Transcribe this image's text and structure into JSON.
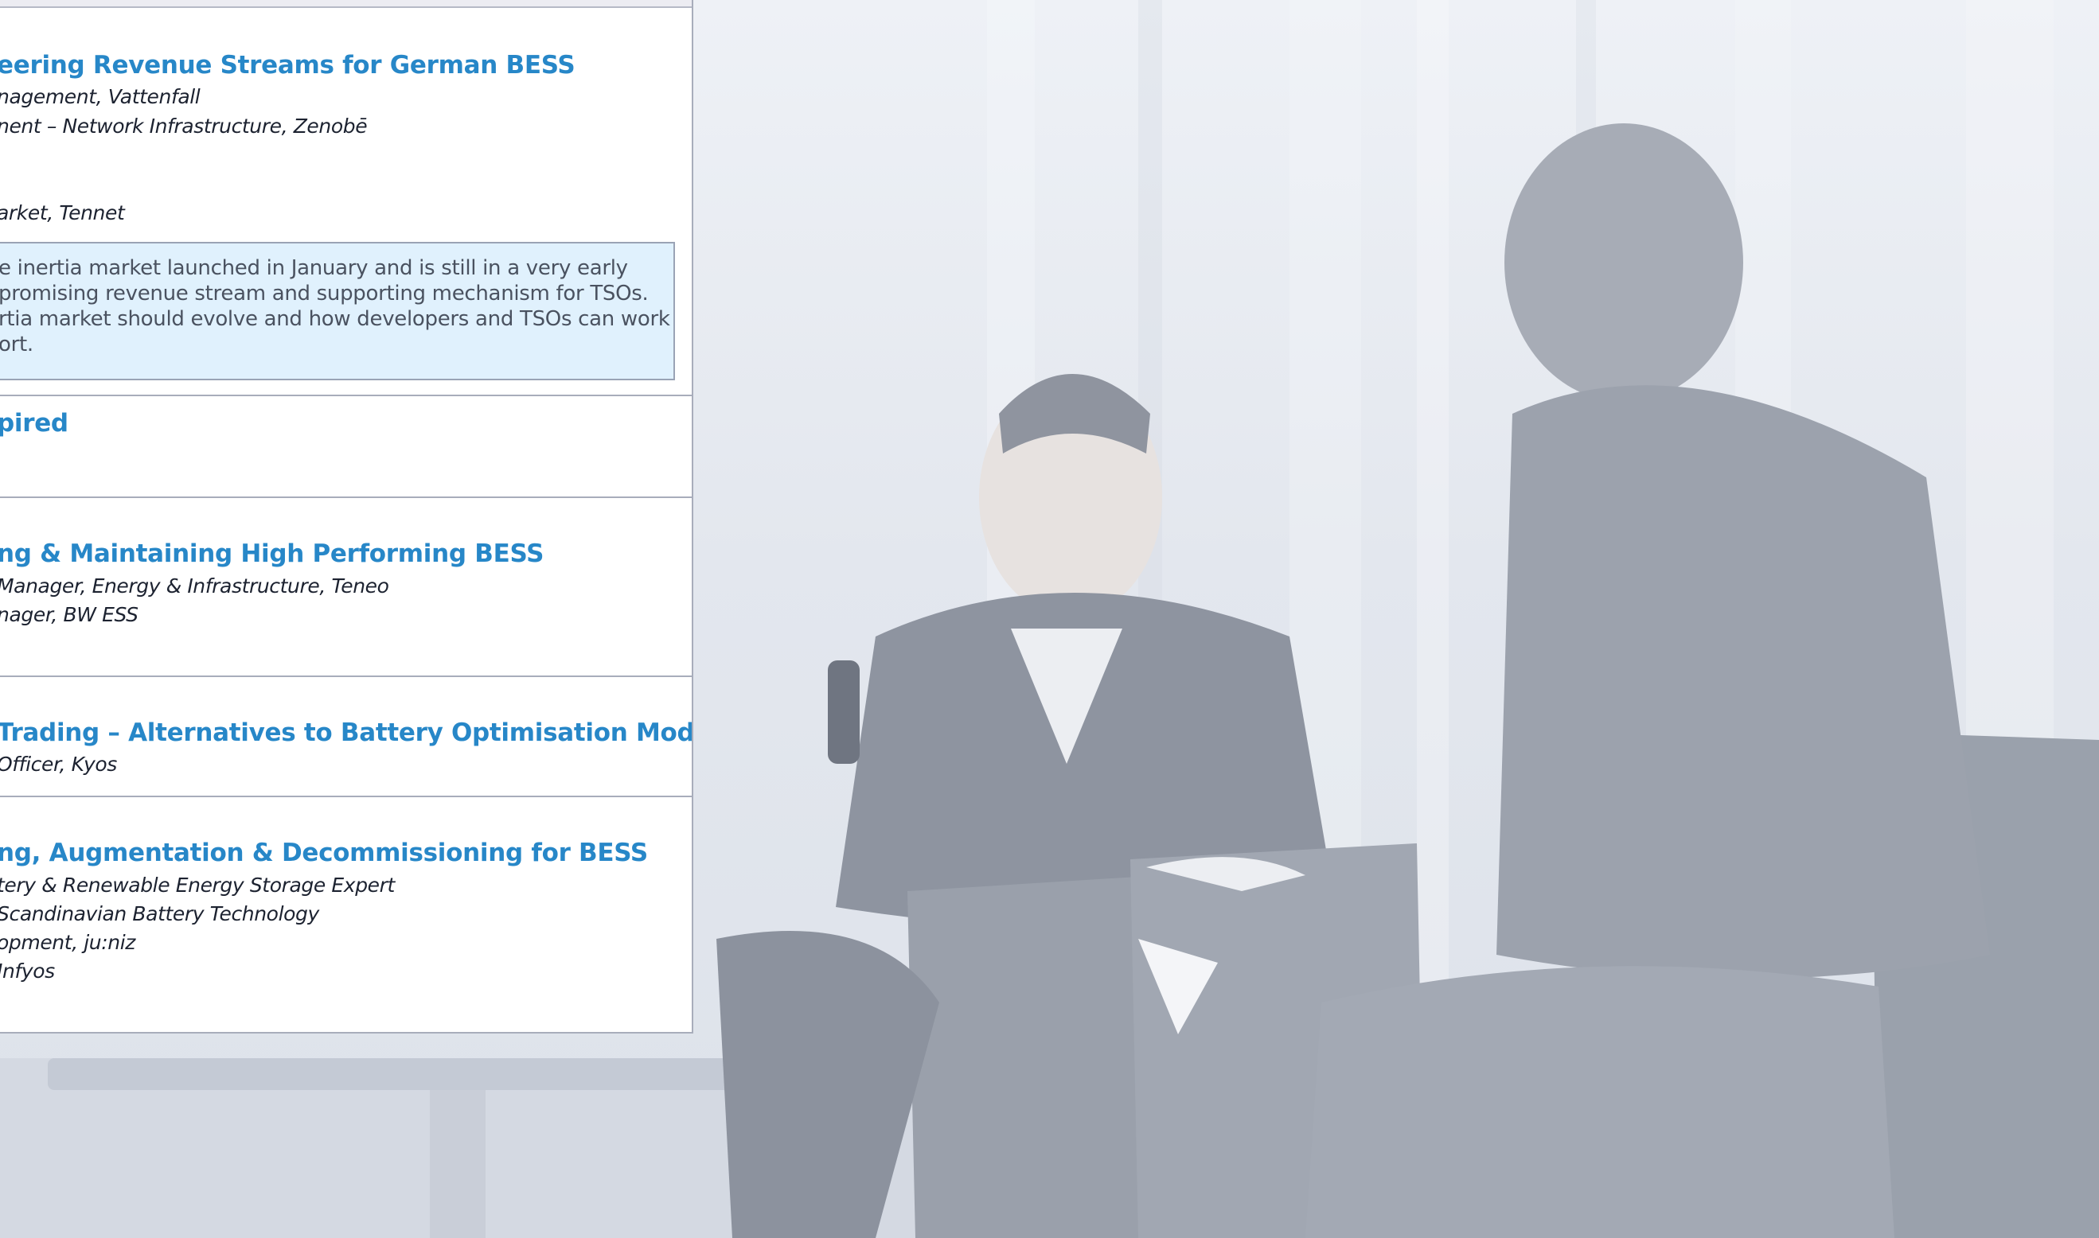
{
  "sessions": [
    {
      "title": "eering Revenue Streams for German BESS",
      "lines": [
        "nagement, Vattenfall",
        "nent – Network Infrastructure, Zenobē",
        "arket, Tennet"
      ],
      "abstract": [
        "e inertia market launched in January and is still in a very early",
        "promising revenue stream and supporting mechanism for TSOs.",
        "rtia market should evolve and how developers and TSOs can work",
        "ort."
      ]
    },
    {
      "title": "pired",
      "lines": []
    },
    {
      "title": "ng & Maintaining High Performing BESS",
      "lines": [
        "Manager, Energy & Infrastructure, Teneo",
        "nager, BW ESS"
      ]
    },
    {
      "title": "Trading – Alternatives to Battery Optimisation Models",
      "lines": [
        "Officer, Kyos"
      ]
    },
    {
      "title": "ng, Augmentation & Decommissioning for BESS",
      "lines": [
        "tery & Renewable Energy Storage Expert",
        "Scandinavian Battery Technology",
        "opment, ju:niz",
        "Infyos"
      ]
    }
  ],
  "background": {
    "photo": "two-people-seated-on-stage-panel-discussion",
    "tint": "#e4e8ef"
  },
  "colors": {
    "title": "#2787c8",
    "abstract_fill": "#e0f1fd",
    "divider": "#a8adbb"
  }
}
